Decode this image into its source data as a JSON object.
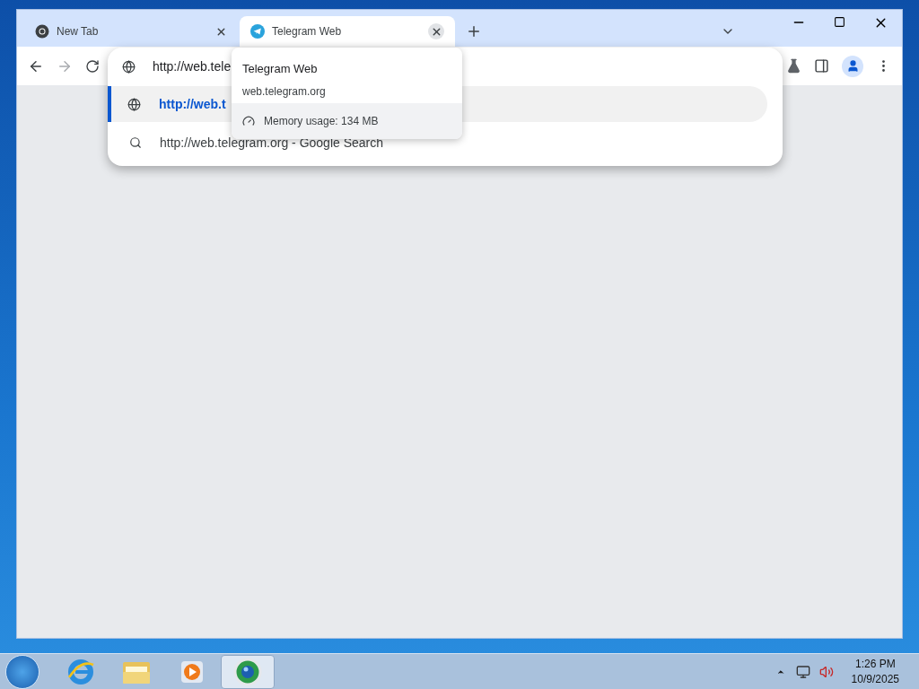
{
  "tabs": [
    {
      "title": "New Tab",
      "kind": "chrome",
      "selected": false
    },
    {
      "title": "Telegram Web",
      "kind": "telegram",
      "selected": true
    }
  ],
  "omnibox": {
    "value": "http://web.tele"
  },
  "suggestions": [
    {
      "kind": "url",
      "text": "http://web.t",
      "selected": true
    },
    {
      "kind": "search",
      "text": "http://web.telegram.org - Google Search",
      "selected": false
    }
  ],
  "tab_tooltip": {
    "title": "Telegram Web",
    "url": "web.telegram.org",
    "memory": "Memory usage: 134 MB"
  },
  "taskbar": {
    "apps": [
      {
        "kind": "ie",
        "selected": false
      },
      {
        "kind": "explorer",
        "selected": false
      },
      {
        "kind": "media",
        "selected": false
      },
      {
        "kind": "chrome",
        "selected": true
      }
    ],
    "time": "1:26 PM",
    "date": "10/9/2025"
  }
}
